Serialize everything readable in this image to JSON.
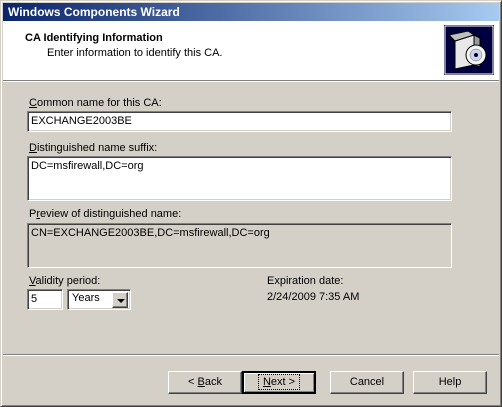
{
  "window": {
    "title": "Windows Components Wizard"
  },
  "header": {
    "title": "CA Identifying Information",
    "subtitle": "Enter information to identify this CA.",
    "icon": "setup-box-cd-icon"
  },
  "form": {
    "common_name": {
      "label_mnemonic": "C",
      "label_rest": "ommon name for this CA:",
      "value": "EXCHANGE2003BE"
    },
    "dn_suffix": {
      "label_mnemonic": "D",
      "label_rest": "istinguished name suffix:",
      "value": "DC=msfirewall,DC=org"
    },
    "dn_preview": {
      "label_pre": "P",
      "label_mnemonic": "r",
      "label_rest": "eview of distinguished name:",
      "value": "CN=EXCHANGE2003BE,DC=msfirewall,DC=org"
    },
    "validity": {
      "label_mnemonic": "V",
      "label_rest": "alidity period:",
      "value": "5",
      "unit": "Years"
    },
    "expiration": {
      "label": "Expiration date:",
      "value": "2/24/2009 7:35 AM"
    }
  },
  "buttons": {
    "back": {
      "lead": "< ",
      "mnemonic": "B",
      "rest": "ack"
    },
    "next": {
      "mnemonic": "N",
      "rest": "ext >"
    },
    "cancel": "Cancel",
    "help": "Help"
  }
}
